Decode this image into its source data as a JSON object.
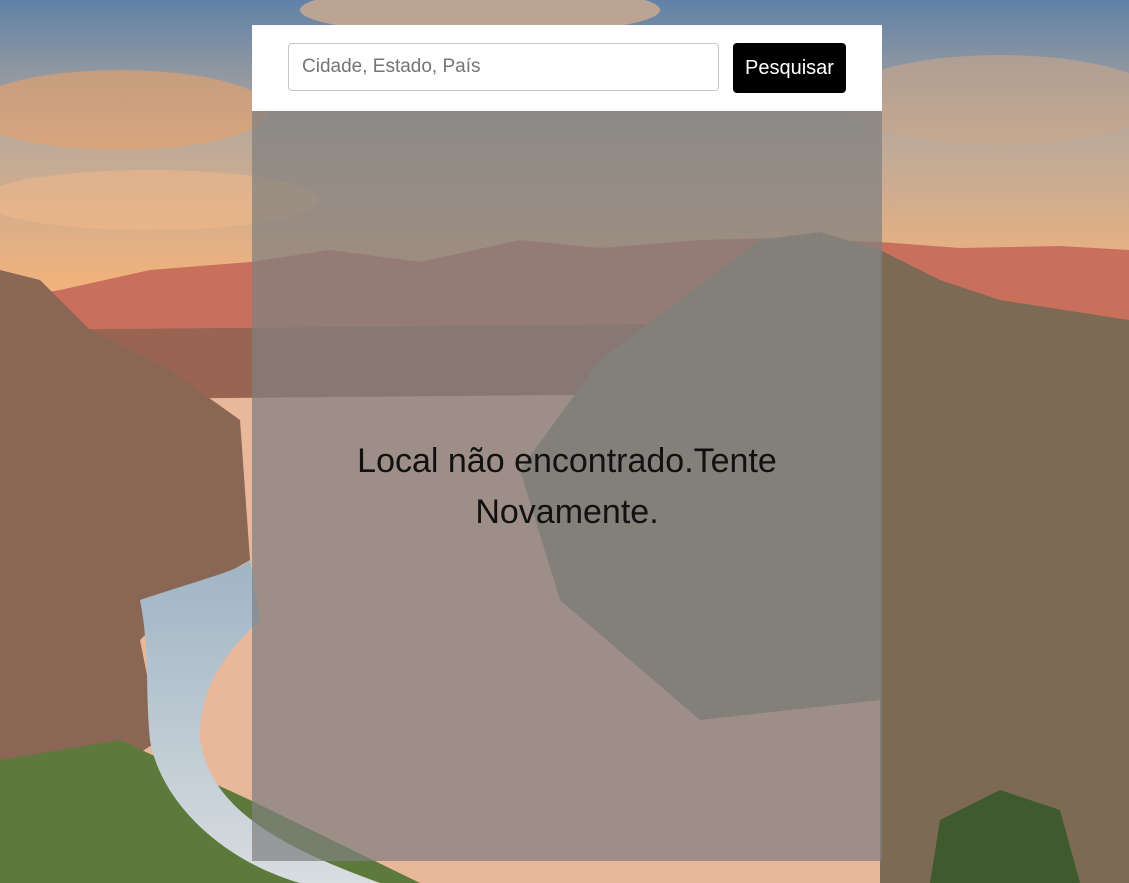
{
  "search": {
    "placeholder": "Cidade, Estado, País",
    "value": "",
    "button_label": "Pesquisar"
  },
  "result": {
    "message": "Local não encontrado.Tente Novamente."
  },
  "background": {
    "image": "canyon-landscape",
    "colors": {
      "sky_top": "#6d8fb0",
      "sky_glow": "#f2b07a",
      "cliffs": "#c46a5a",
      "canyon": "#7a5a45",
      "vegetation": "#5d7a3c",
      "river": "#c9d6dc"
    }
  }
}
